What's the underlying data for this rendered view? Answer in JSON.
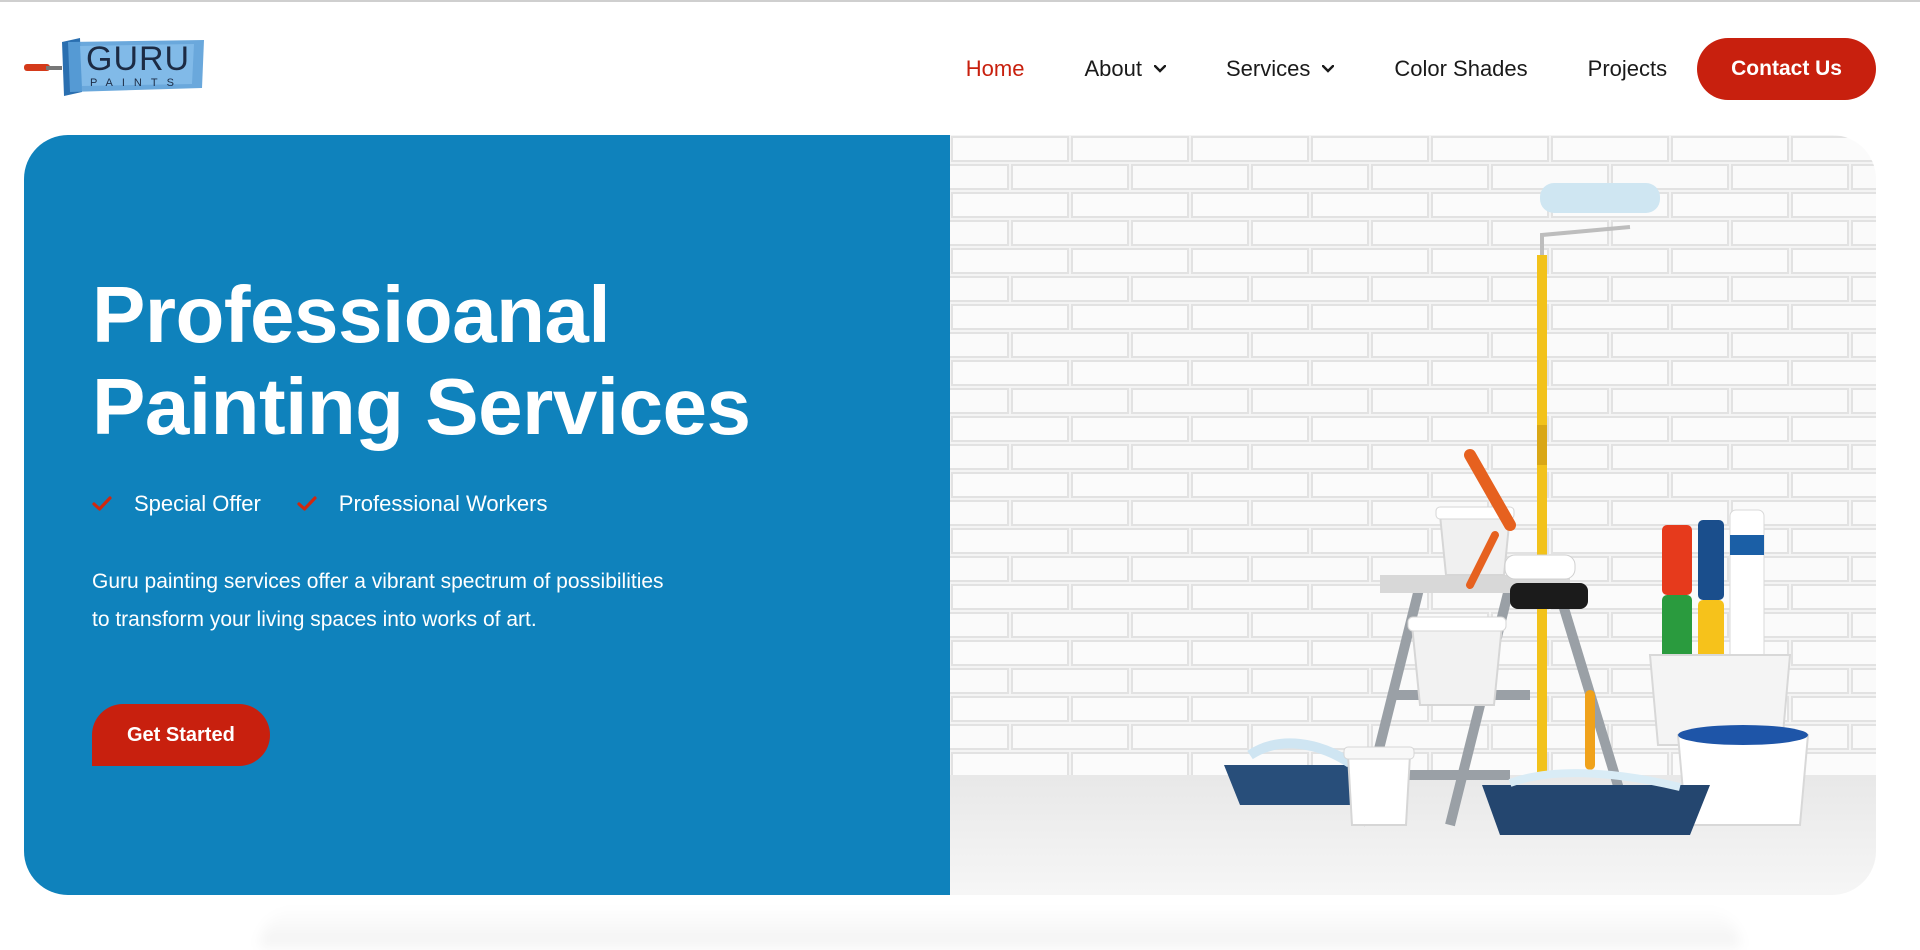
{
  "brand": {
    "logo_text": "GURU",
    "logo_subtext": "PAINTS"
  },
  "nav": {
    "items": [
      {
        "label": "Home",
        "active": true,
        "dropdown": false
      },
      {
        "label": "About",
        "active": false,
        "dropdown": true
      },
      {
        "label": "Services",
        "active": false,
        "dropdown": true
      },
      {
        "label": "Color Shades",
        "active": false,
        "dropdown": false
      },
      {
        "label": "Projects",
        "active": false,
        "dropdown": false
      }
    ],
    "contact_label": "Contact Us"
  },
  "hero": {
    "title_line1": "Professioanal",
    "title_line2": "Painting Services",
    "features": [
      "Special Offer",
      "Professional Workers"
    ],
    "description": "Guru painting services offer a vibrant spectrum of possibilities to transform your living spaces into works of art.",
    "cta_label": "Get Started"
  },
  "colors": {
    "brand_red": "#c8200e",
    "hero_blue": "#0f82bc"
  },
  "icons": [
    "paint-roller-icon",
    "chevron-down-icon",
    "check-icon"
  ]
}
